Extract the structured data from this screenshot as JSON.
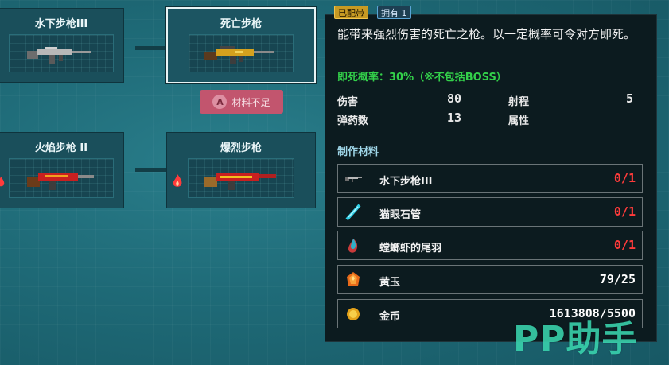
{
  "tree": {
    "nodes": [
      {
        "title": "水下步枪III"
      },
      {
        "title": "死亡步枪"
      },
      {
        "title": "火焰步枪 II"
      },
      {
        "title": "爆烈步枪"
      }
    ],
    "status_button": {
      "key": "A",
      "label": "材料不足"
    }
  },
  "detail": {
    "tags": {
      "equipped": "已配带",
      "owned": "拥有 1"
    },
    "description": "能带来强烈伤害的死亡之枪。以一定概率可令对方即死。",
    "instakill": "即死概率：30%（※不包括BOSS）",
    "stats": {
      "damage_label": "伤害",
      "damage_value": "80",
      "range_label": "射程",
      "range_value": "5",
      "ammo_label": "弹药数",
      "ammo_value": "13",
      "attribute_label": "属性",
      "attribute_value": ""
    },
    "materials_title": "制作材料",
    "materials": [
      {
        "name": "水下步枪III",
        "count": "0/1",
        "icon": "rifle-icon",
        "color": "#ff3b3b"
      },
      {
        "name": "猫眼石管",
        "count": "0/1",
        "icon": "tube-icon",
        "color": "#ff3b3b"
      },
      {
        "name": "螳螂虾的尾羽",
        "count": "0/1",
        "icon": "feather-icon",
        "color": "#ff3b3b"
      },
      {
        "name": "黄玉",
        "count": "79/25",
        "icon": "topaz-icon",
        "color": "#ffffff"
      },
      {
        "name": "金币",
        "count": "1613808/5500",
        "icon": "coin-icon",
        "color": "#ffffff"
      }
    ]
  },
  "watermark": "PP助手",
  "colors": {
    "danger": "#ff3b3b",
    "success": "#33d14a",
    "accent": "#9fd6e8"
  }
}
